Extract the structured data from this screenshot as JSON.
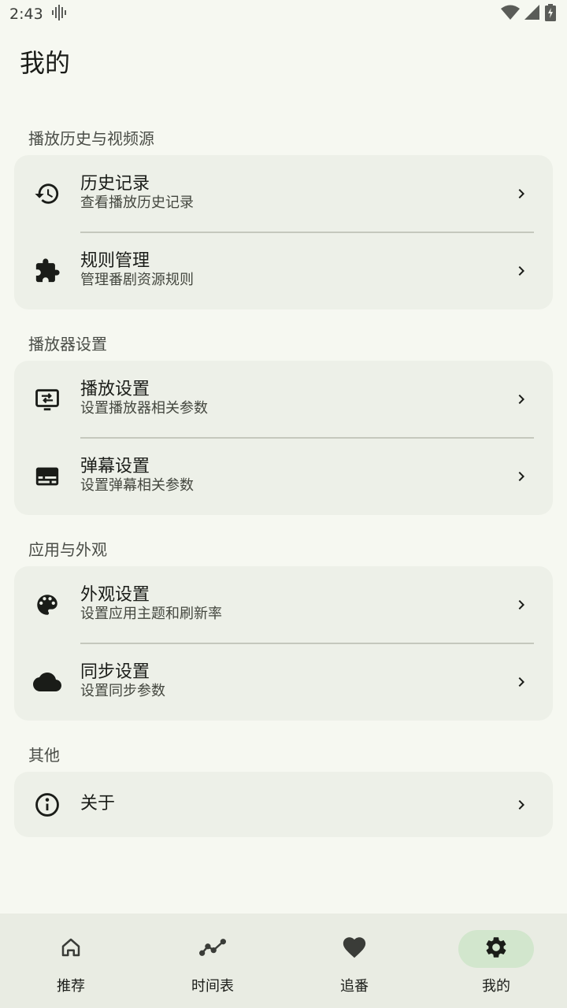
{
  "status_bar": {
    "time": "2:43"
  },
  "page": {
    "title": "我的"
  },
  "sections": {
    "history": {
      "header": "播放历史与视频源",
      "items": [
        {
          "title": "历史记录",
          "subtitle": "查看播放历史记录",
          "icon": "history-icon"
        },
        {
          "title": "规则管理",
          "subtitle": "管理番剧资源规则",
          "icon": "puzzle-icon"
        }
      ]
    },
    "player": {
      "header": "播放器设置",
      "items": [
        {
          "title": "播放设置",
          "subtitle": "设置播放器相关参数",
          "icon": "player-settings-icon"
        },
        {
          "title": "弹幕设置",
          "subtitle": "设置弹幕相关参数",
          "icon": "danmaku-icon"
        }
      ]
    },
    "appearance": {
      "header": "应用与外观",
      "items": [
        {
          "title": "外观设置",
          "subtitle": "设置应用主题和刷新率",
          "icon": "palette-icon"
        },
        {
          "title": "同步设置",
          "subtitle": "设置同步参数",
          "icon": "cloud-icon"
        }
      ]
    },
    "other": {
      "header": "其他",
      "items": [
        {
          "title": "关于",
          "icon": "info-icon"
        }
      ]
    }
  },
  "bottom_nav": {
    "items": [
      {
        "label": "推荐",
        "icon": "home-icon"
      },
      {
        "label": "时间表",
        "icon": "timeline-icon"
      },
      {
        "label": "追番",
        "icon": "heart-icon"
      },
      {
        "label": "我的",
        "icon": "gear-icon",
        "active": true
      }
    ]
  },
  "colors": {
    "background": "#f6f8f1",
    "card": "#edf0e8",
    "active_pill": "#d2e6cd",
    "text": "#1a1c18"
  }
}
